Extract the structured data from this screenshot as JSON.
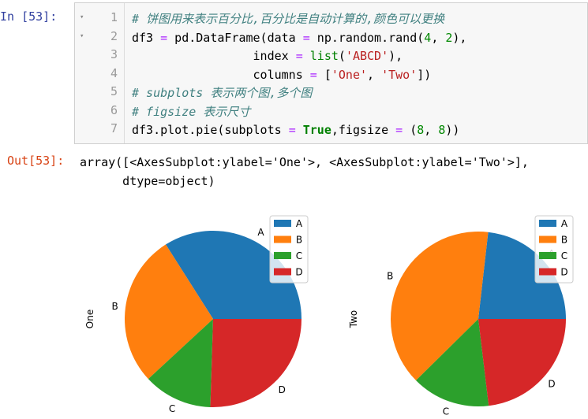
{
  "cell": {
    "in_prompt": "In  [53]:",
    "out_prompt": "Out[53]:",
    "line_numbers": [
      "1",
      "2",
      "3",
      "4",
      "5",
      "6",
      "7"
    ],
    "fold_markers": [
      "▾",
      "▾"
    ],
    "code_lines": [
      [
        [
          "# 饼图用来表示百分比,百分比是自动计算的,颜色可以更换",
          "c-com"
        ]
      ],
      [
        [
          "df3 ",
          ""
        ],
        [
          "=",
          "c-op"
        ],
        [
          " pd.DataFrame(data ",
          ""
        ],
        [
          "=",
          "c-op"
        ],
        [
          " np.random.rand(",
          ""
        ],
        [
          "4",
          "c-num"
        ],
        [
          ", ",
          ""
        ],
        [
          "2",
          "c-num"
        ],
        [
          "),",
          ""
        ]
      ],
      [
        [
          "                 index ",
          ""
        ],
        [
          "=",
          "c-op"
        ],
        [
          " ",
          ""
        ],
        [
          "list",
          "c-bi"
        ],
        [
          "(",
          ""
        ],
        [
          "'ABCD'",
          "c-str"
        ],
        [
          "),",
          ""
        ]
      ],
      [
        [
          "                 columns ",
          ""
        ],
        [
          "=",
          "c-op"
        ],
        [
          " [",
          ""
        ],
        [
          "'One'",
          "c-str"
        ],
        [
          ", ",
          ""
        ],
        [
          "'Two'",
          "c-str"
        ],
        [
          "])",
          ""
        ]
      ],
      [
        [
          "# subplots 表示两个图,多个图",
          "c-com"
        ]
      ],
      [
        [
          "# figsize 表示尺寸",
          "c-com"
        ]
      ],
      [
        [
          "df3.plot.pie(subplots ",
          ""
        ],
        [
          "=",
          "c-op"
        ],
        [
          " ",
          ""
        ],
        [
          "True",
          "c-kw"
        ],
        [
          ",figsize ",
          ""
        ],
        [
          "=",
          "c-op"
        ],
        [
          " (",
          ""
        ],
        [
          "8",
          "c-num"
        ],
        [
          ", ",
          ""
        ],
        [
          "8",
          "c-num"
        ],
        [
          "))",
          ""
        ]
      ]
    ],
    "output_text": "array([<AxesSubplot:ylabel='One'>, <AxesSubplot:ylabel='Two'>],\n      dtype=object)"
  },
  "chart_data": [
    {
      "type": "pie",
      "ylabel": "One",
      "categories": [
        "A",
        "B",
        "C",
        "D"
      ],
      "values": [
        0.34,
        0.279,
        0.126,
        0.255
      ],
      "colors": [
        "#1f77b4",
        "#ff7f0e",
        "#2ca02c",
        "#d62728"
      ],
      "start_angle_deg": 0,
      "direction": "counterclockwise",
      "legend": {
        "entries": [
          "A",
          "B",
          "C",
          "D"
        ],
        "placement": "upper-right"
      }
    },
    {
      "type": "pie",
      "ylabel": "Two",
      "categories": [
        "A",
        "B",
        "C",
        "D"
      ],
      "values": [
        0.232,
        0.392,
        0.145,
        0.231
      ],
      "colors": [
        "#1f77b4",
        "#ff7f0e",
        "#2ca02c",
        "#d62728"
      ],
      "start_angle_deg": 0,
      "direction": "counterclockwise",
      "legend": {
        "entries": [
          "A",
          "B",
          "C",
          "D"
        ],
        "placement": "upper-right"
      }
    }
  ]
}
